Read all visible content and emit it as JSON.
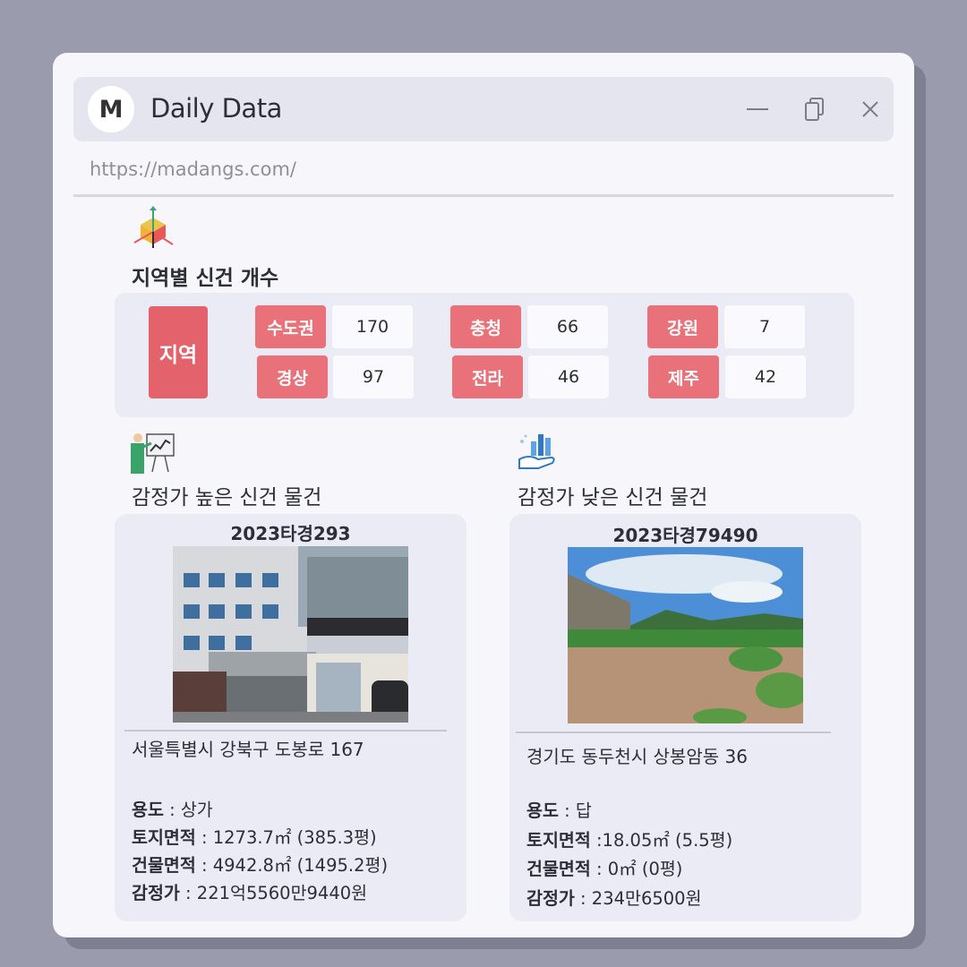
{
  "window": {
    "logo_letter": "M",
    "title": "Daily Data",
    "url": "https://madangs.com/",
    "controls": [
      "minimize-icon",
      "copy-icon",
      "close-icon"
    ]
  },
  "region_section": {
    "icon": "cube-axes-icon",
    "title": "지역별 신건 개수",
    "label": "지역",
    "regions": [
      {
        "name": "수도권",
        "count": "170"
      },
      {
        "name": "충청",
        "count": "66"
      },
      {
        "name": "강원",
        "count": "7"
      },
      {
        "name": "경상",
        "count": "97"
      },
      {
        "name": "전라",
        "count": "46"
      },
      {
        "name": "제주",
        "count": "42"
      }
    ]
  },
  "high_section": {
    "icon": "presentation-chart-icon",
    "title": "감정가 높은 신건 물건",
    "case_no": "2023타경293",
    "photo": "building-storefront-photo",
    "address": "서울특별시 강북구 도봉로 167",
    "usage_label": "용도",
    "usage": " : 상가",
    "land_label": "토지면적",
    "land": " : 1273.7㎡ (385.3평)",
    "building_label": "건물면적",
    "building": " : 4942.8㎡ (1495.2평)",
    "price_label": "감정가",
    "price": " : 221억5560만9440원"
  },
  "low_section": {
    "icon": "hand-bar-chart-icon",
    "title": "감정가 낮은 신건 물건",
    "case_no": "2023타경79490",
    "photo": "farmland-photo",
    "address": "경기도 동두천시 상봉암동 36",
    "usage_label": "용도",
    "usage": " : 답",
    "land_label": "토지면적",
    "land": " :18.05㎡ (5.5평)",
    "building_label": "건물면적",
    "building": " : 0㎡ (0평)",
    "price_label": "감정가",
    "price": " : 234만6500원"
  },
  "colors": {
    "background": "#9a9cae",
    "window": "#f6f6fb",
    "titlebar": "#e4e5ee",
    "panel": "#ebebf5",
    "region_tag": "#e8717a",
    "region_main": "#e4626c"
  }
}
